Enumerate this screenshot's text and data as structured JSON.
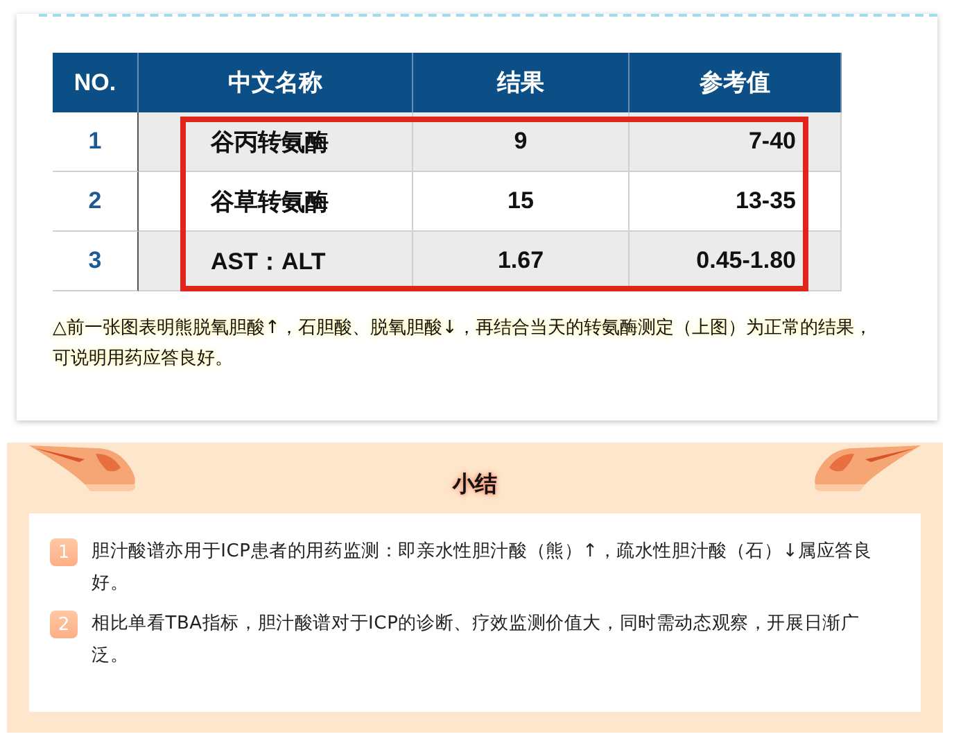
{
  "table": {
    "columns": [
      "NO.",
      "中文名称",
      "结果",
      "参考值"
    ],
    "rows": [
      {
        "no": "1",
        "name": "谷丙转氨酶",
        "result": "9",
        "reference": "7-40"
      },
      {
        "no": "2",
        "name": "谷草转氨酶",
        "result": "15",
        "reference": "13-35"
      },
      {
        "no": "3",
        "name": "AST：ALT",
        "result": "1.67",
        "reference": "0.45-1.80"
      }
    ]
  },
  "caption": "△前一张图表明熊脱氧胆酸↑，石胆酸、脱氧胆酸↓，再结合当天的转氨酶测定（上图）为正常的结果，可说明用药应答良好。",
  "summary": {
    "title": "小结",
    "items": [
      {
        "number": "1",
        "text": "胆汁酸谱亦用于ICP患者的用药监测：即亲水性胆汁酸（熊）↑，疏水性胆汁酸（石）↓属应答良好。"
      },
      {
        "number": "2",
        "text": "相比单看TBA指标，胆汁酸谱对于ICP的诊断、疗效监测价值大，同时需动态观察，开展日渐广泛。"
      }
    ]
  }
}
